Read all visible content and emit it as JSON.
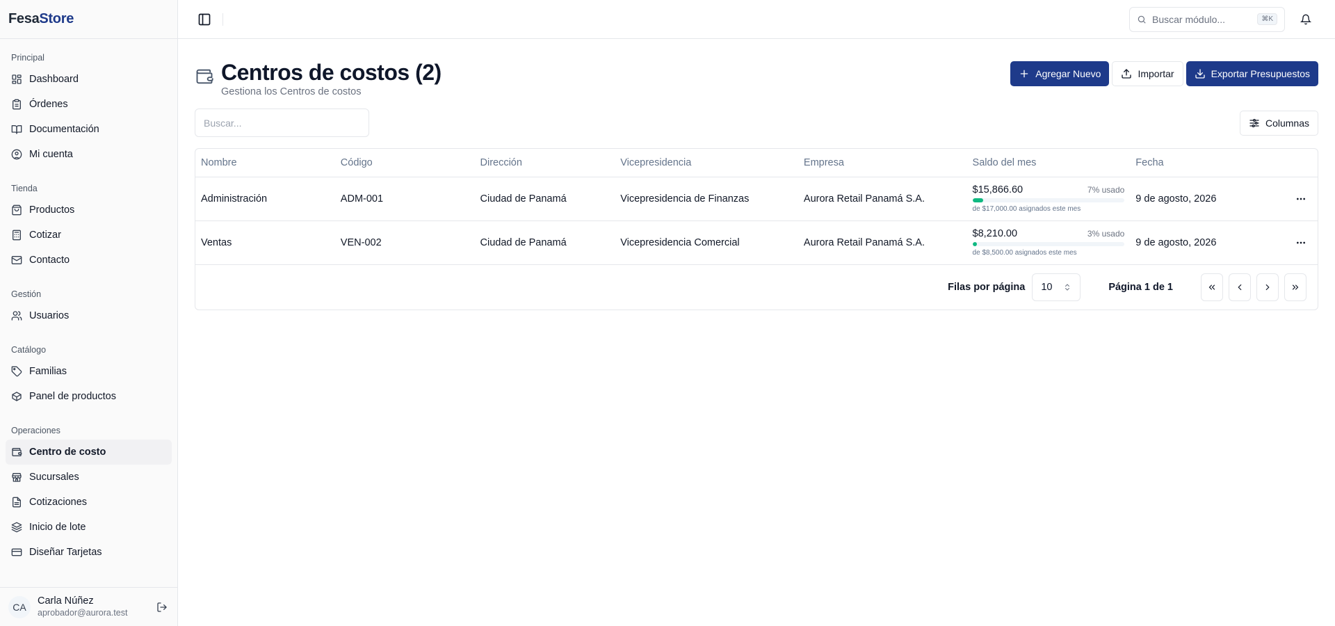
{
  "brand": {
    "part1": "Fesa",
    "part2": "Store"
  },
  "sidebar": {
    "groups": [
      {
        "label": "Principal",
        "items": [
          {
            "label": "Dashboard",
            "icon": "dashboard-grid-icon"
          },
          {
            "label": "Órdenes",
            "icon": "clipboard-icon"
          },
          {
            "label": "Documentación",
            "icon": "book-open-icon"
          },
          {
            "label": "Mi cuenta",
            "icon": "user-circle-icon"
          }
        ]
      },
      {
        "label": "Tienda",
        "items": [
          {
            "label": "Productos",
            "icon": "shopping-bag-icon"
          },
          {
            "label": "Cotizar",
            "icon": "calculator-icon"
          },
          {
            "label": "Contacto",
            "icon": "mail-icon"
          }
        ]
      },
      {
        "label": "Gestión",
        "items": [
          {
            "label": "Usuarios",
            "icon": "users-icon"
          }
        ]
      },
      {
        "label": "Catálogo",
        "items": [
          {
            "label": "Familias",
            "icon": "tag-icon"
          },
          {
            "label": "Panel de productos",
            "icon": "package-icon"
          }
        ]
      },
      {
        "label": "Operaciones",
        "items": [
          {
            "label": "Centro de costo",
            "icon": "wallet-icon",
            "active": true
          },
          {
            "label": "Sucursales",
            "icon": "store-icon"
          },
          {
            "label": "Cotizaciones",
            "icon": "file-text-icon"
          },
          {
            "label": "Inicio de lote",
            "icon": "layers-icon"
          },
          {
            "label": "Diseñar Tarjetas",
            "icon": "credit-card-icon"
          }
        ]
      }
    ]
  },
  "user": {
    "initials": "CA",
    "name": "Carla Núñez",
    "email": "aprobador@aurora.test"
  },
  "topbar": {
    "search_placeholder": "Buscar módulo...",
    "shortcut": "⌘K"
  },
  "page": {
    "title": "Centros de costos (2)",
    "subtitle": "Gestiona los Centros de costos"
  },
  "actions": {
    "add": "Agregar Nuevo",
    "import": "Importar",
    "export": "Exportar Presupuestos"
  },
  "toolbar": {
    "search_placeholder": "Buscar...",
    "columns": "Columnas"
  },
  "table": {
    "headers": [
      "Nombre",
      "Código",
      "Dirección",
      "Vicepresidencia",
      "Empresa",
      "Saldo del mes",
      "Fecha"
    ],
    "rows": [
      {
        "nombre": "Administración",
        "codigo": "ADM-001",
        "direccion": "Ciudad de Panamá",
        "vicepresidencia": "Vicepresidencia de Finanzas",
        "empresa": "Aurora Retail Panamá S.A.",
        "saldo": "$15,866.60",
        "pct_label": "7% usado",
        "pct": 7,
        "note": "de $17,000.00 asignados este mes",
        "fecha": "9 de agosto, 2026"
      },
      {
        "nombre": "Ventas",
        "codigo": "VEN-002",
        "direccion": "Ciudad de Panamá",
        "vicepresidencia": "Vicepresidencia Comercial",
        "empresa": "Aurora Retail Panamá S.A.",
        "saldo": "$8,210.00",
        "pct_label": "3% usado",
        "pct": 3,
        "note": "de $8,500.00 asignados este mes",
        "fecha": "9 de agosto, 2026"
      }
    ]
  },
  "pagination": {
    "rows_label": "Filas por página",
    "rows_value": "10",
    "page_info": "Página 1 de 1"
  },
  "colors": {
    "brand": "#1e3a8a",
    "progress": "#10b981"
  }
}
